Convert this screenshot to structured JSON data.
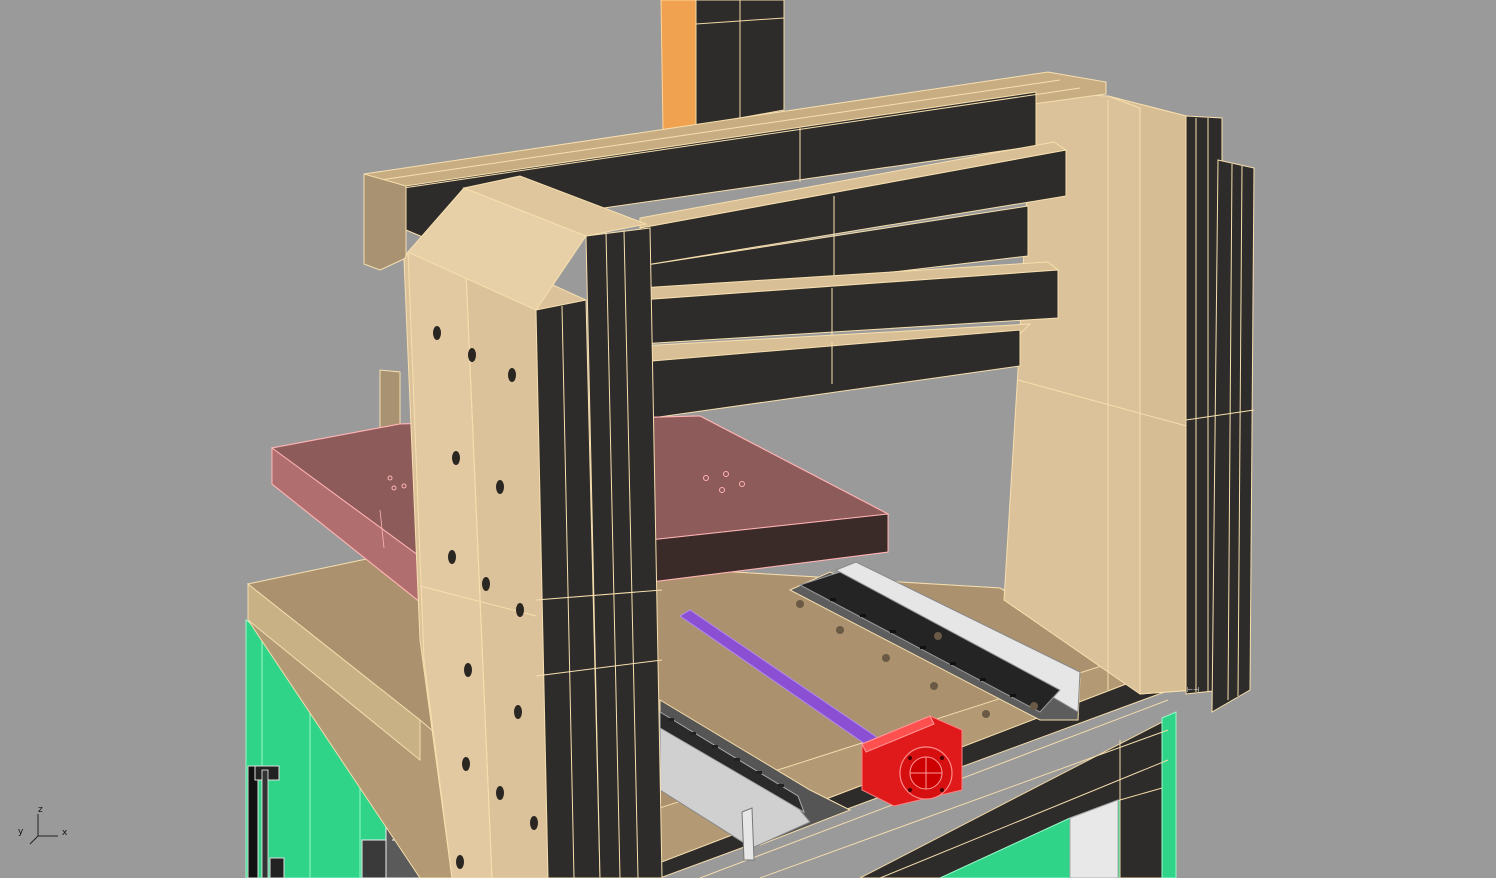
{
  "viewport": {
    "background": "#9a9a9a",
    "axes": {
      "z": "z",
      "y": "y",
      "x": "x"
    }
  },
  "colors": {
    "frame_tan": "#dcc29a",
    "frame_tan_dark": "#c7aa7c",
    "frame_tan_side": "#b89e76",
    "frame_black": "#2e2c2a",
    "edge_highlight": "#f6dfae",
    "base_plate": "#bfa880",
    "base_plate_dark": "#9c8464",
    "enclosure_green": "#2fd489",
    "selected_plate": "#9a6262",
    "selected_outline": "#ffb3b3",
    "ballscrew_purple": "#8a4fd2",
    "motor_red": "#e01a1a",
    "rail_white": "#e6e6e6",
    "rail_grey": "#7c7c7c",
    "z_column_orange": "#f0a250"
  }
}
